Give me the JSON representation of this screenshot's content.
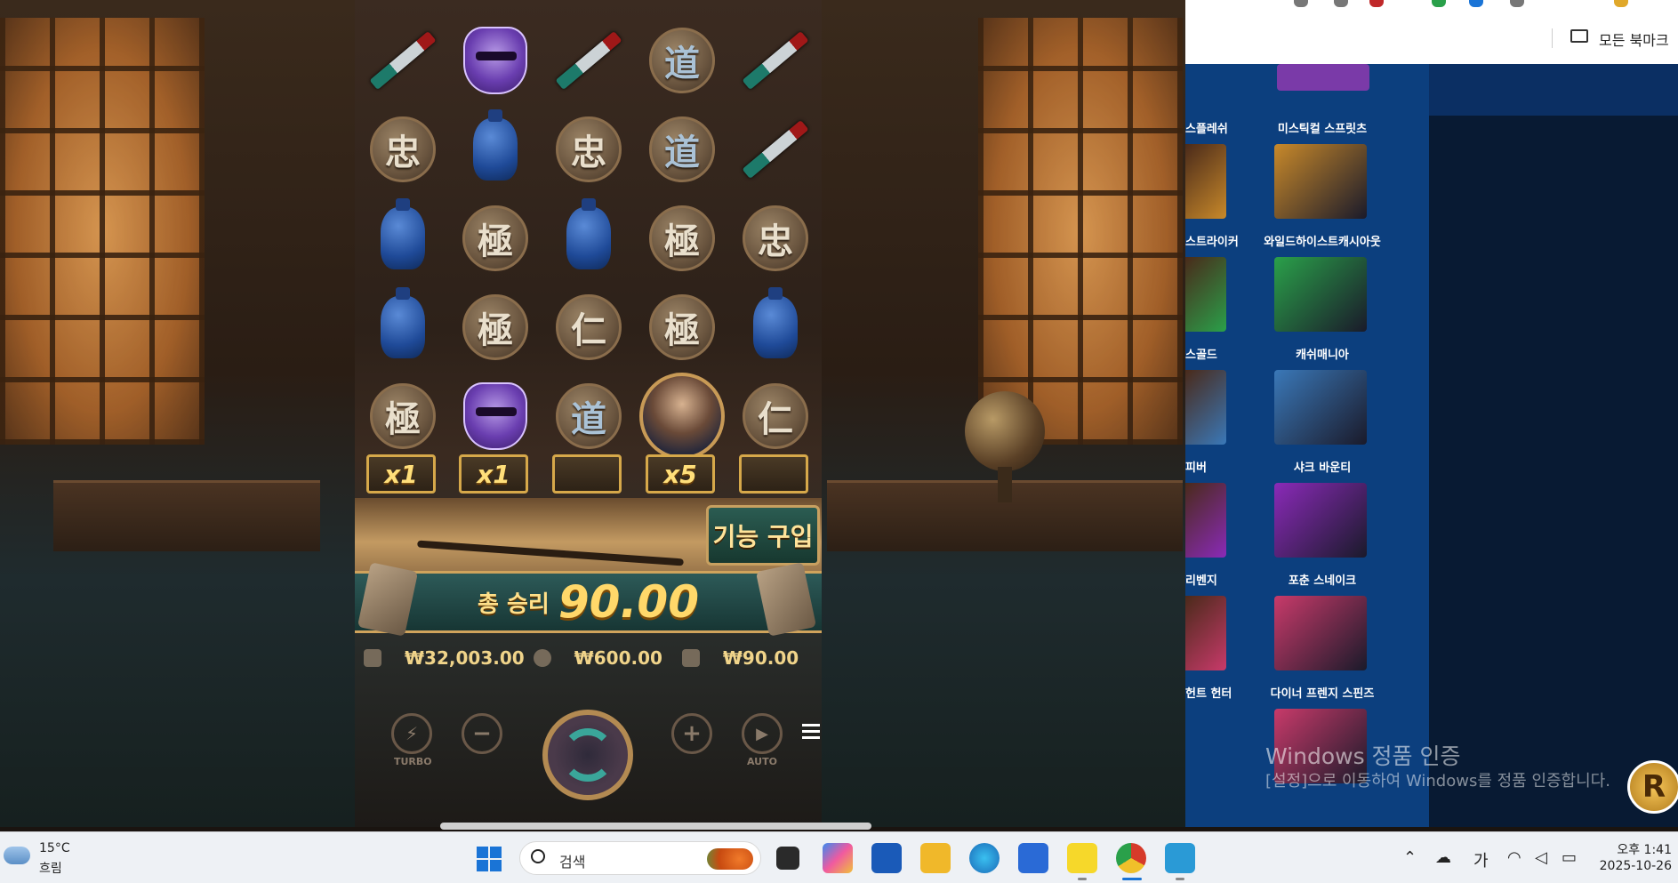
{
  "game": {
    "rows": [
      [
        {
          "type": "knife"
        },
        {
          "type": "mask"
        },
        {
          "type": "knife"
        },
        {
          "type": "kanji",
          "glyph": "道",
          "tone": "blue"
        },
        {
          "type": "knife"
        }
      ],
      [
        {
          "type": "kanji",
          "glyph": "忠"
        },
        {
          "type": "vase"
        },
        {
          "type": "kanji",
          "glyph": "忠"
        },
        {
          "type": "kanji",
          "glyph": "道",
          "tone": "blue"
        },
        {
          "type": "knife"
        }
      ],
      [
        {
          "type": "vase"
        },
        {
          "type": "kanji",
          "glyph": "極"
        },
        {
          "type": "vase"
        },
        {
          "type": "kanji",
          "glyph": "極"
        },
        {
          "type": "kanji",
          "glyph": "忠"
        }
      ],
      [
        {
          "type": "vase"
        },
        {
          "type": "kanji",
          "glyph": "極"
        },
        {
          "type": "kanji",
          "glyph": "仁"
        },
        {
          "type": "kanji",
          "glyph": "極"
        },
        {
          "type": "vase"
        }
      ],
      [
        {
          "type": "kanji",
          "glyph": "極"
        },
        {
          "type": "mask"
        },
        {
          "type": "kanji",
          "glyph": "道",
          "tone": "blue"
        },
        {
          "type": "portrait"
        },
        {
          "type": "kanji",
          "glyph": "仁"
        }
      ]
    ],
    "multipliers": [
      "x1",
      "x1",
      "",
      "x5",
      ""
    ],
    "feature_buy_label": "기능 구입",
    "total_win_label": "총 승리",
    "total_win_value": "90.00",
    "balance": "₩32,003.00",
    "bet": "₩600.00",
    "win": "₩90.00",
    "controls": {
      "turbo_label": "TURBO",
      "minus_glyph": "−",
      "plus_glyph": "+",
      "auto_label": "AUTO",
      "play_glyph": "▶",
      "turbo_glyph": "⚡"
    }
  },
  "browser": {
    "bookmarks_label": "모든 북마크"
  },
  "casino": {
    "games": [
      {
        "name": "미스틱컬 스프릿츠",
        "partial": "스플레쉬",
        "tile_color": "#7a3aa8"
      },
      {
        "name": "와일드하이스트캐시아웃",
        "partial": "스트라이커",
        "tile_color": "#c8892a"
      },
      {
        "name": "캐쉬매니아",
        "partial": "스골드",
        "tile_color": "#2aa04a"
      },
      {
        "name": "샤크 바운티",
        "partial": "피버",
        "tile_color": "#3a78b8"
      },
      {
        "name": "포춘 스네이크",
        "partial": "리벤지",
        "tile_color": "#8a2ab8"
      },
      {
        "name": "다이너 프렌지 스핀즈",
        "partial": "헌트 헌터",
        "tile_color": "#c83a6a"
      }
    ],
    "windows_activation_title": "Windows 정품 인증",
    "windows_activation_desc": "[설정]으로 이동하여 Windows를 정품 인증합니다.",
    "badge_letter": "R"
  },
  "taskbar": {
    "temperature": "15°C",
    "weather": "흐림",
    "search_placeholder": "검색",
    "ime_label": "가",
    "time": "오후 1:41",
    "date": "2025-10-26",
    "apps": [
      "task-view",
      "copilot",
      "store",
      "file-explorer",
      "edge",
      "todo",
      "kakaotalk",
      "chrome",
      "notepad"
    ]
  }
}
